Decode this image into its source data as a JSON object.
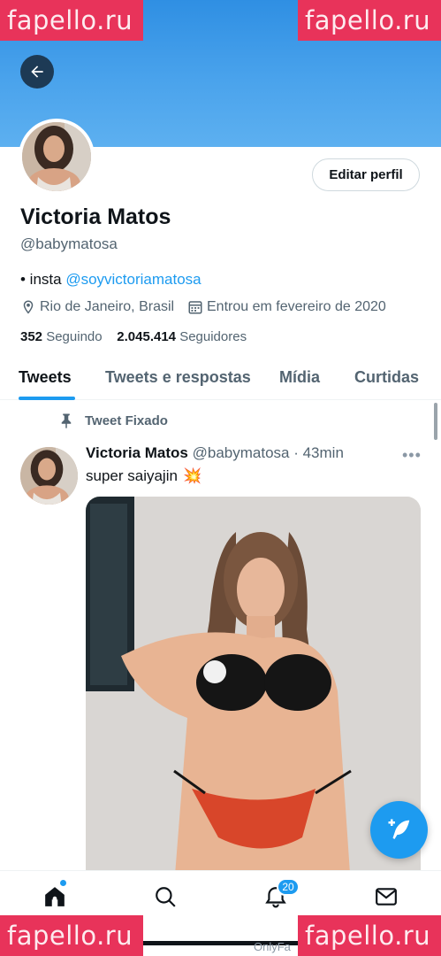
{
  "watermarks": {
    "text": "fapello.ru"
  },
  "profile": {
    "name": "Victoria Matos",
    "handle": "@babymatosa",
    "edit_label": "Editar perfil",
    "bio_prefix": "• insta ",
    "bio_link": "@soyvictoriamatosa",
    "location": "Rio de Janeiro, Brasil",
    "joined": "Entrou em fevereiro de 2020",
    "following_count": "352",
    "following_label": "Seguindo",
    "followers_count": "2.045.414",
    "followers_label": "Seguidores"
  },
  "tabs": [
    {
      "label": "Tweets",
      "active": true
    },
    {
      "label": "Tweets e respostas",
      "active": false
    },
    {
      "label": "Mídia",
      "active": false
    },
    {
      "label": "Curtidas",
      "active": false
    }
  ],
  "tweet": {
    "pinned_label": "Tweet Fixado",
    "author_name": "Victoria Matos",
    "author_meta": "@babymatosa · 43min",
    "more": "•••",
    "text": "super saiyajin",
    "emoji": "💥"
  },
  "bottom_nav": {
    "notifications_badge": "20",
    "footer_text": "OnlyFa"
  },
  "colors": {
    "accent": "#1d9bf0",
    "banner": "#4aa3ec",
    "watermark": "#e8335a"
  }
}
